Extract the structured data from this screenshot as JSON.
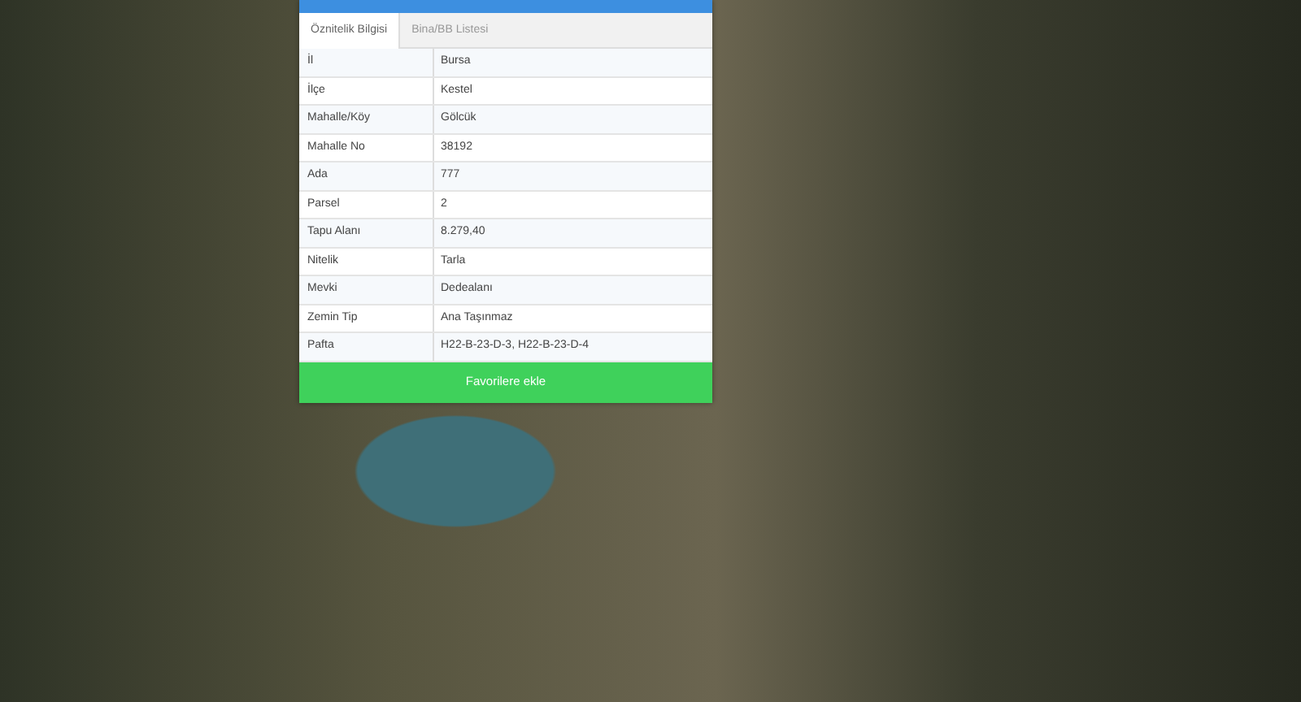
{
  "panel": {
    "tabs": [
      {
        "label": "Öznitelik Bilgisi",
        "selected": true
      },
      {
        "label": "Bina/BB Listesi",
        "selected": false
      }
    ],
    "rows": [
      {
        "label": "İl",
        "value": "Bursa"
      },
      {
        "label": "İlçe",
        "value": "Kestel"
      },
      {
        "label": "Mahalle/Köy",
        "value": "Gölcük"
      },
      {
        "label": "Mahalle No",
        "value": "38192"
      },
      {
        "label": "Ada",
        "value": "777"
      },
      {
        "label": "Parsel",
        "value": "2"
      },
      {
        "label": "Tapu Alanı",
        "value": "8.279,40"
      },
      {
        "label": "Nitelik",
        "value": "Tarla"
      },
      {
        "label": "Mevki",
        "value": "Dedealanı"
      },
      {
        "label": "Zemin Tip",
        "value": "Ana Taşınmaz"
      },
      {
        "label": "Pafta",
        "value": "H22-B-23-D-3, H22-B-23-D-4"
      }
    ],
    "button": "Favorilere ekle"
  }
}
